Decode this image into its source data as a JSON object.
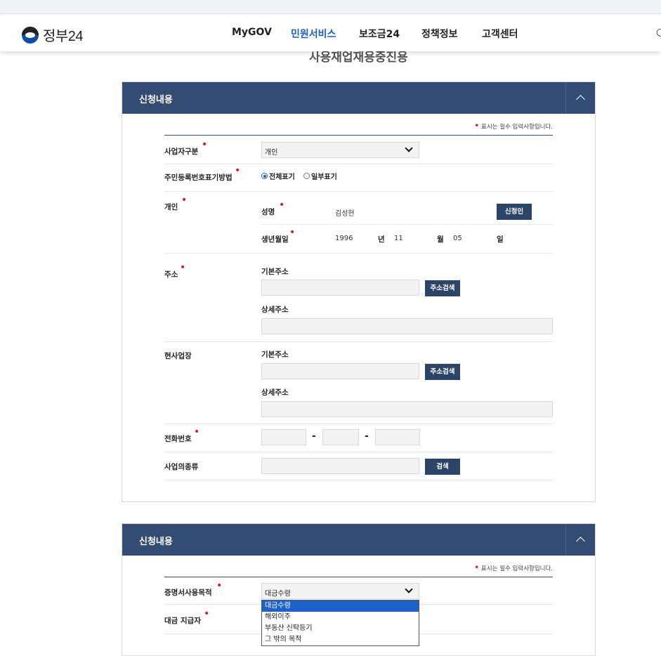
{
  "header": {
    "logo_text": "정부24",
    "nav": [
      "MyGOV",
      "민원서비스",
      "보조금24",
      "정책정보",
      "고객센터"
    ],
    "active_nav": "민원서비스",
    "clipped_text": "사용재업재용중진용"
  },
  "panel1": {
    "title": "신청내용",
    "required_note": "표시는 필수 입력사항입니다.",
    "business_type": {
      "label": "사업자구분",
      "value": "개인"
    },
    "rrn_method": {
      "label": "주민등록번호표기방법",
      "options": [
        "전체표기",
        "일부표기"
      ],
      "selected": "전체표기"
    },
    "individual": {
      "label": "개인",
      "name_label": "성명",
      "name_value": "김성현",
      "applicant_button": "신청인",
      "birth_label": "생년월일",
      "birth_year": "1996",
      "year_unit": "년",
      "birth_month": "11",
      "month_unit": "월",
      "birth_day": "05",
      "day_unit": "일"
    },
    "address": {
      "label": "주소",
      "basic_label": "기본주소",
      "detail_label": "상세주소",
      "search_button": "주소검색"
    },
    "worksite": {
      "label": "현사업장",
      "basic_label": "기본주소",
      "detail_label": "상세주소",
      "search_button": "주소검색"
    },
    "phone": {
      "label": "전화번호",
      "sep": "-"
    },
    "business_kind": {
      "label": "사업의종류",
      "search_button": "검색"
    }
  },
  "panel2": {
    "title": "신청내용",
    "required_note": "표시는 필수 입력사항입니다.",
    "purpose": {
      "label": "증명서사용목적",
      "value": "대금수령",
      "options": [
        "대금수령",
        "해외이주",
        "부동산 신탁등기",
        "그 밖의 목적"
      ]
    },
    "payer_label": "대금 지급자"
  }
}
